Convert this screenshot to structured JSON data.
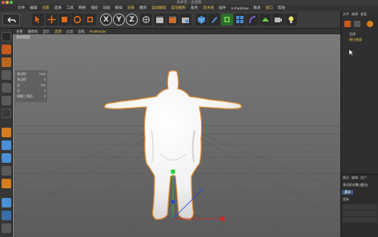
{
  "window": {
    "title": "未命名 - 主视图"
  },
  "colors": {
    "accent": "#e6c34a",
    "icon_orange": "#e06a1b",
    "icon_blue": "#4b8fd6",
    "axis_red": "#e02020",
    "axis_green": "#20d040",
    "axis_blue": "#2040e0",
    "selection_orange": "#e08a2c"
  },
  "menubar": {
    "items": [
      "文件",
      "编辑",
      "创建",
      "选择",
      "工具",
      "网格",
      "捕捉",
      "动画",
      "模拟",
      "渲染",
      "雕刻",
      "运动跟踪",
      "运动图形",
      "角色",
      "流水线",
      "插件",
      "X-Particles",
      "脆本",
      "窗口",
      "帮助"
    ]
  },
  "toolbar": {
    "axis_x": "X",
    "axis_y": "Y",
    "axis_z": "Z"
  },
  "viewport": {
    "menu": [
      "查看",
      "摄像机",
      "显示",
      "选项",
      "过滤",
      "面板",
      "ProRender"
    ],
    "label": "透视视图",
    "info": [
      {
        "label": "多边形",
        "value": "7104"
      },
      {
        "label": "多边形",
        "value": "0"
      },
      {
        "label": "边",
        "value": "761"
      },
      {
        "label": "点",
        "value": "0"
      },
      {
        "label": "网格三角形",
        "value": "0"
      }
    ]
  },
  "right_panel": {
    "menu": [
      "文件",
      "编辑",
      "查看"
    ],
    "tree": [
      {
        "label": "主体"
      },
      {
        "label": "细分曲面"
      }
    ],
    "attr_menu": [
      "模式",
      "编辑",
      "用户"
    ],
    "attr_title": "多边形对象 [细分]",
    "attr_tab": "基本",
    "attr_section": "坐标"
  }
}
